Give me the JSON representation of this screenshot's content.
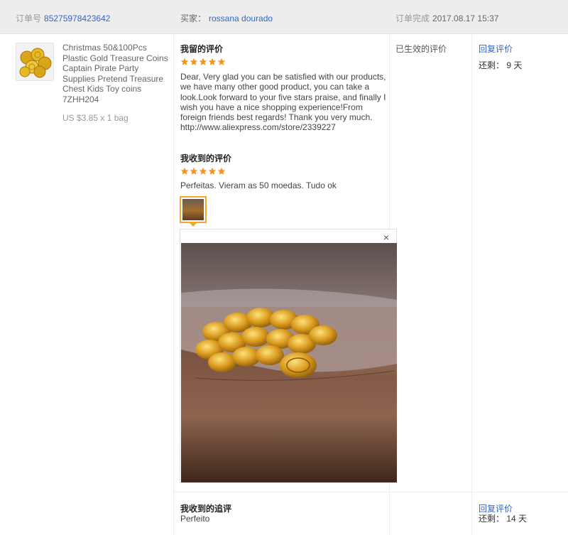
{
  "header": {
    "order_label": "订单号",
    "order_number": "85275978423642",
    "buyer_label": "买家：",
    "buyer_name": "rossana dourado",
    "completed_label": "订单完成",
    "completed_time": "2017.08.17 15:37"
  },
  "product": {
    "title": "Christmas 50&100Pcs Plastic Gold Treasure Coins Captain Pirate Party Supplies Pretend Treasure Chest Kids Toy coins 7ZHH204",
    "price": "US $3.85 x 1 bag",
    "thumbnail_icon": "gold-coins-image"
  },
  "my_review": {
    "title": "我留的评价",
    "stars": 5,
    "text": "Dear, Very glad you can be satisfied with our products, we have many other good product, you can take a look.Look forward to your five stars praise, and finally I wish you have a nice shopping experience!From foreign friends best regards! Thank you very much.",
    "url": "http://www.aliexpress.com/store/2339227"
  },
  "received_review": {
    "title": "我收到的评价",
    "stars": 5,
    "text": "Perfeitas. Vieram as 50 moedas. Tudo ok",
    "photo_icon": "customer-photo-gold-coins",
    "close_icon": "close-icon",
    "close_glyph": "×"
  },
  "followup_review": {
    "title": "我收到的追评",
    "text": "Perfeito"
  },
  "status": {
    "text": "已生效的评价"
  },
  "actions": {
    "reply_label": "回复评价",
    "remaining_1": "还剩： 9 天",
    "reply_label_2": "回复评价",
    "remaining_2": "还剩： 14 天"
  },
  "colors": {
    "header_bg": "#ededed",
    "link": "#3366cc",
    "star": "#f7941d",
    "thumb_border": "#f1a82e"
  }
}
